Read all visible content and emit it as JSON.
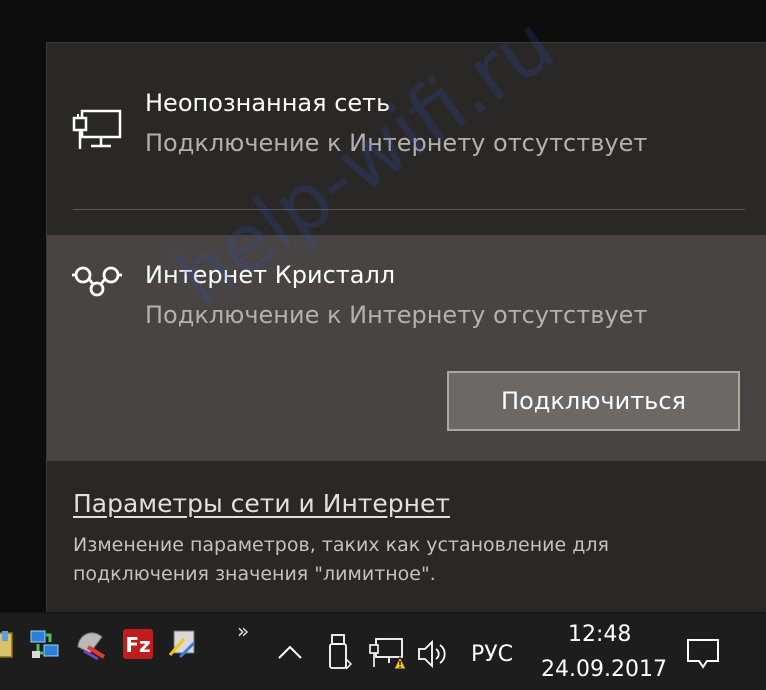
{
  "network_flyout": {
    "networks": [
      {
        "icon": "ethernet-monitor-icon",
        "name": "Неопознанная сеть",
        "status": "Подключение к Интернету отсутствует"
      },
      {
        "icon": "wifi-hotspot-icon",
        "name": "Интернет Кристалл",
        "status": "Подключение к Интернету отсутствует",
        "button_label": "Подключиться"
      }
    ],
    "settings_link": "Параметры сети и Интернет",
    "settings_description": "Изменение параметров, таких как установление для подключения значения \"лимитное\"."
  },
  "watermark": "help-wifi.ru",
  "taskbar": {
    "pinned_apps": [
      "app-icon",
      "network-tool-icon",
      "satellite-app-icon",
      "filezilla-icon",
      "transfer-app-icon"
    ],
    "overflow_label": "»",
    "tray": {
      "show_hidden_icon": "chevron-up-icon",
      "usb_icon": "usb-drive-icon",
      "network_icon": "network-warning-icon",
      "volume_icon": "speaker-icon",
      "language": "РУС",
      "time": "12:48",
      "date": "24.09.2017",
      "notification_icon": "action-center-icon"
    }
  },
  "colors": {
    "flyout_bg": "#2a2827",
    "selected_bg": "#474443",
    "taskbar_bg": "#1e1d1d",
    "warning": "#f2c811"
  }
}
